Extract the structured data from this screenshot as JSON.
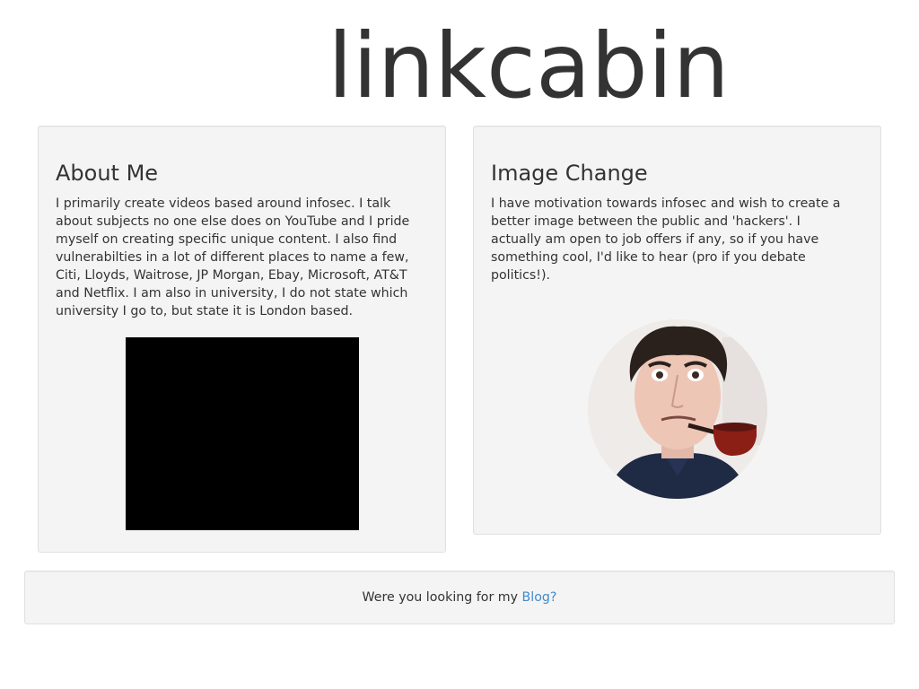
{
  "header": {
    "title": "linkcabin"
  },
  "about": {
    "title": "About Me",
    "text": "I primarily create videos based around infosec. I talk about subjects no one else does on YouTube and I pride myself on creating specific unique content. I also find vulnerabilties in a lot of different places to name a few, Citi, Lloyds, Waitrose, JP Morgan, Ebay, Microsoft, AT&T and Netflix. I am also in university, I do not state which university I go to, but state it is London based."
  },
  "image_change": {
    "title": "Image Change",
    "text": "I have motivation towards infosec and wish to create a better image between the public and 'hackers'. I actually am open to job offers if any, so if you have something cool, I'd like to hear (pro if you debate politics!)."
  },
  "footer": {
    "text": "Were you looking for my ",
    "link_label": "Blog?"
  },
  "colors": {
    "link": "#428bca",
    "well_background": "#f4f4f4",
    "text": "#333333"
  }
}
